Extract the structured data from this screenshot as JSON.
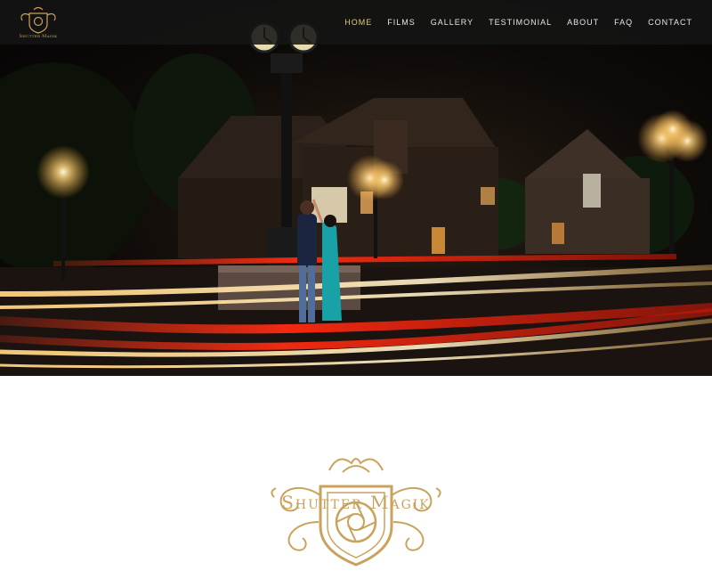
{
  "header": {
    "brand_text": "Shutter Magik",
    "nav": [
      {
        "label": "HOME",
        "active": true
      },
      {
        "label": "FILMS",
        "active": false
      },
      {
        "label": "GALLERY",
        "active": false
      },
      {
        "label": "TESTIMONIAL",
        "active": false
      },
      {
        "label": "ABOUT",
        "active": false
      },
      {
        "label": "FAQ",
        "active": false
      },
      {
        "label": "CONTACT",
        "active": false
      }
    ]
  },
  "hero": {
    "image_alt": "couple-dancing-under-clock-night-light-trails-photo"
  },
  "logo_section": {
    "wordmark": "Shutter Magik"
  },
  "colors": {
    "nav_bg": "#141414",
    "nav_text": "#e6e6e6",
    "nav_active": "#e2c87c",
    "gold": "#c9a35d"
  },
  "icons": {
    "brand_logo": "crest-aperture-icon",
    "crest": "crest-aperture-icon"
  }
}
